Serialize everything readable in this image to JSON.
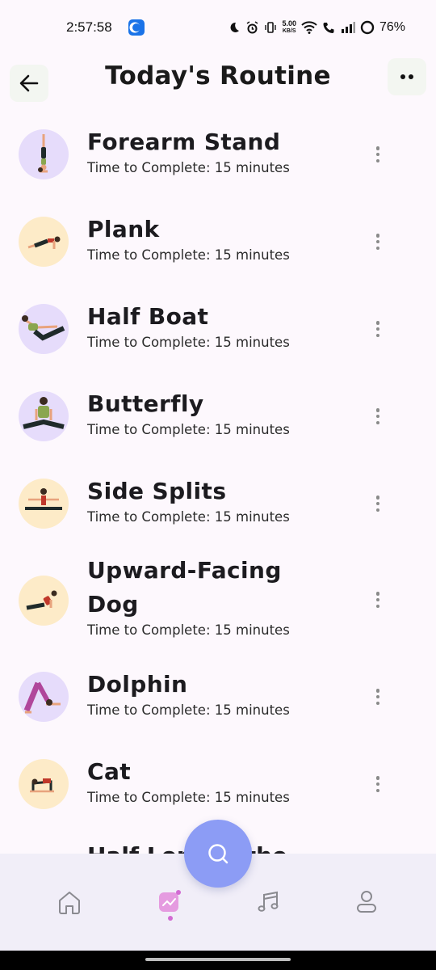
{
  "status_bar": {
    "time": "2:57:58",
    "net_speed_value": "5.00",
    "net_speed_unit": "KB/S",
    "battery": "76%"
  },
  "header": {
    "title": "Today's Routine"
  },
  "routines": [
    {
      "name": "Forearm Stand",
      "subtitle": "Time to Complete: 15 minutes",
      "bg": "purple"
    },
    {
      "name": "Plank",
      "subtitle": "Time to Complete: 15 minutes",
      "bg": "cream"
    },
    {
      "name": "Half Boat",
      "subtitle": "Time to Complete: 15 minutes",
      "bg": "purple"
    },
    {
      "name": "Butterfly",
      "subtitle": "Time to Complete: 15 minutes",
      "bg": "purple"
    },
    {
      "name": "Side Splits",
      "subtitle": "Time to Complete: 15 minutes",
      "bg": "cream"
    },
    {
      "name": "Upward-Facing Dog",
      "subtitle": "Time to Complete: 15 minutes",
      "bg": "cream"
    },
    {
      "name": "Dolphin",
      "subtitle": "Time to Complete: 15 minutes",
      "bg": "purple"
    },
    {
      "name": "Cat",
      "subtitle": "Time to Complete: 15 minutes",
      "bg": "cream"
    }
  ],
  "partial_item_text": "Half Lord of the",
  "bottom_nav": {
    "items": [
      {
        "icon": "home-icon",
        "active": false
      },
      {
        "icon": "activity-chart-icon",
        "active": true
      },
      {
        "icon": "music-note-icon",
        "active": false
      },
      {
        "icon": "profile-icon",
        "active": false
      }
    ]
  },
  "fab": {
    "icon": "search-icon"
  },
  "colors": {
    "fab": "#8c9cf5",
    "active_nav": "#d26bd3",
    "thumb_purple": "#e6dcfb",
    "thumb_cream": "#fdebc8",
    "nav_bg": "#f1eef8"
  }
}
